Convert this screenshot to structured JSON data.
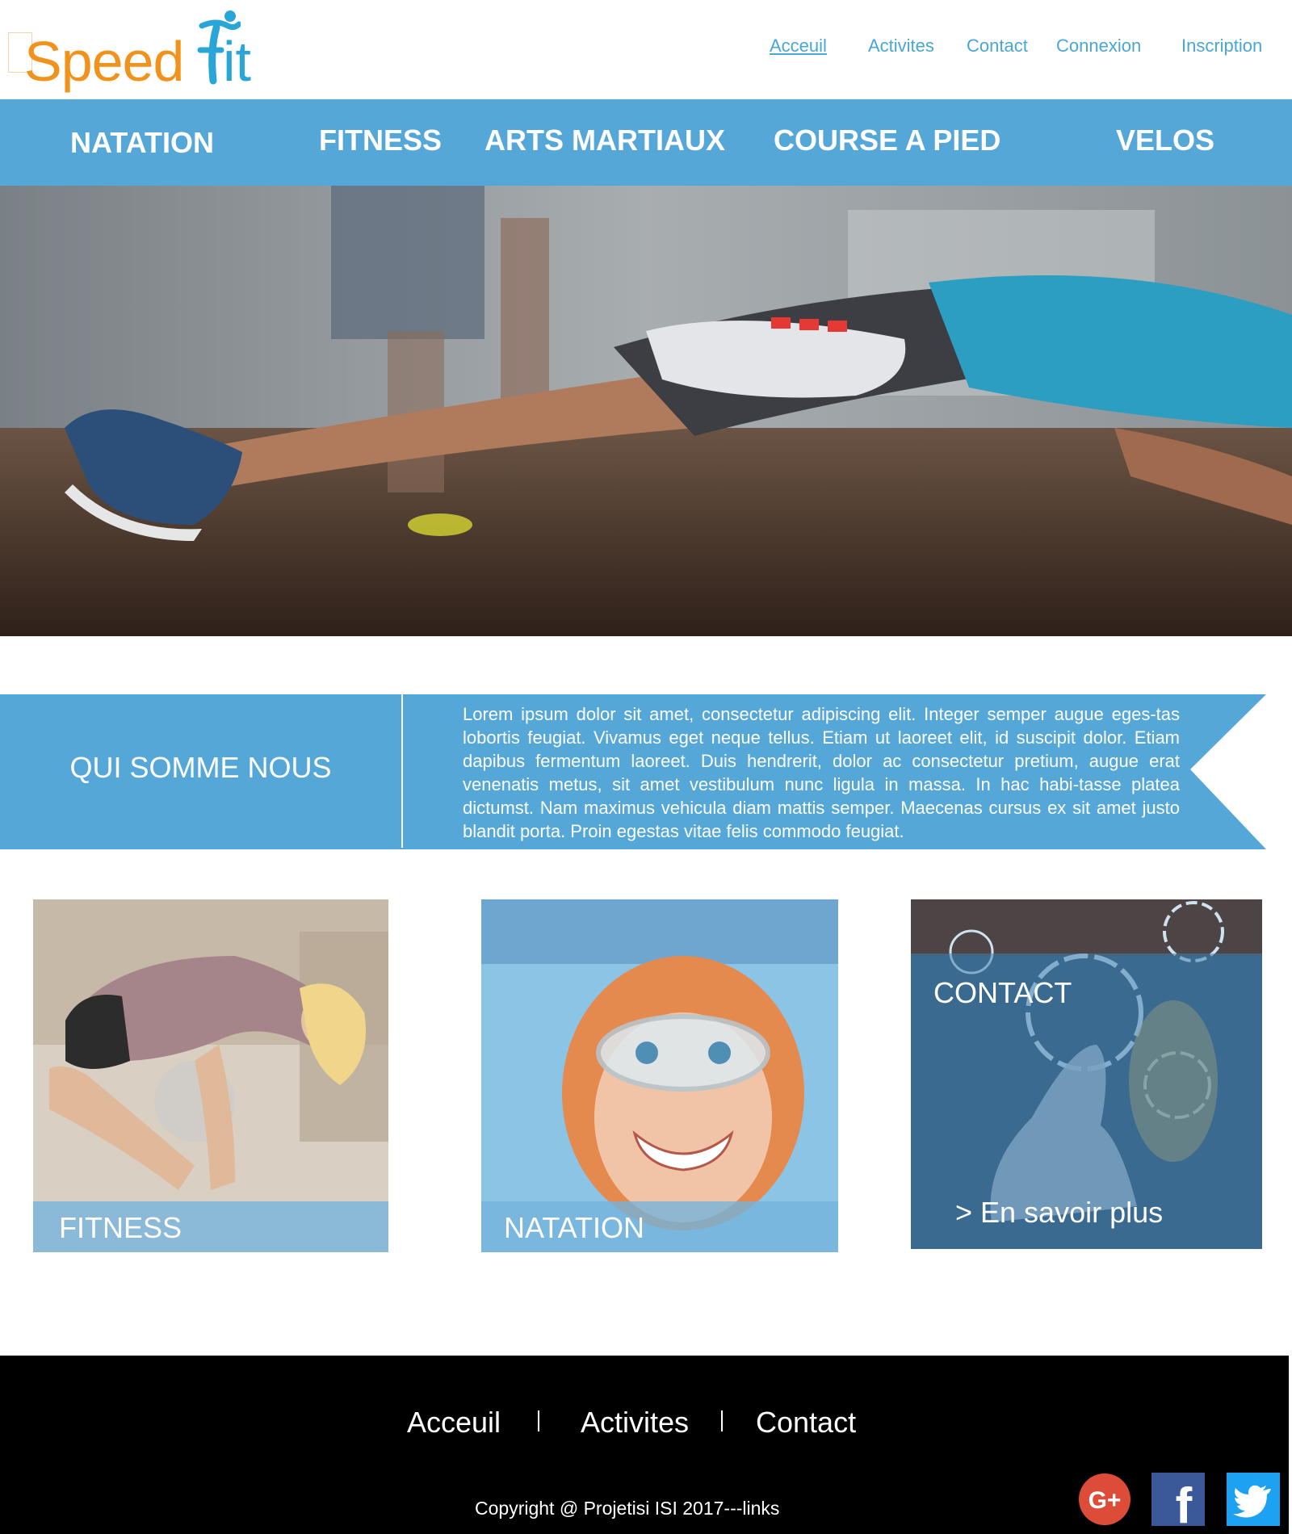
{
  "brand": {
    "part1": "Speed",
    "part2": "it",
    "color_primary": "#f0921b",
    "color_secondary": "#29a5d8"
  },
  "top_nav": {
    "items": [
      {
        "label": "Acceuil",
        "active": true
      },
      {
        "label": "Activites"
      },
      {
        "label": "Contact"
      },
      {
        "label": "Connexion"
      },
      {
        "label": "Inscription"
      }
    ]
  },
  "categories": [
    "NATATION",
    "FITNESS",
    "ARTS MARTIAUX",
    "COURSE A PIED",
    "VELOS"
  ],
  "hero": {
    "image": "workout-sneakers-plank-photo"
  },
  "about": {
    "title": "QUI SOMME NOUS",
    "text": "Lorem ipsum dolor sit amet, consectetur adipiscing elit. Integer semper augue eges-tas lobortis feugiat. Vivamus eget neque tellus. Etiam ut laoreet elit, id suscipit dolor. Etiam dapibus fermentum laoreet. Duis hendrerit, dolor ac consectetur pretium, augue erat venenatis metus, sit amet vestibulum nunc ligula in massa. In hac habi-tasse platea dictumst. Nam maximus vehicula diam mattis semper. Maecenas cursus ex sit amet justo blandit porta. Proin egestas vitae felis commodo feugiat.",
    "accent": "#55a7d8"
  },
  "cards": [
    {
      "label": "FITNESS",
      "image": "woman-fitness-photo"
    },
    {
      "label": "NATATION",
      "image": "girl-swimming-goggles-photo"
    },
    {
      "label": "CONTACT",
      "more": "> En savoir plus",
      "image": "mail-touch-photo"
    }
  ],
  "footer": {
    "nav": [
      "Acceuil",
      "Activites",
      "Contact"
    ],
    "copyright": "Copyright @ Projetisi ISI 2017---links",
    "social": [
      {
        "icon": "google-plus-icon",
        "glyph": "G+",
        "color": "#dd4b39"
      },
      {
        "icon": "facebook-icon",
        "glyph": "f",
        "color": "#3b5998"
      },
      {
        "icon": "twitter-icon",
        "glyph": "t",
        "color": "#1da1f2"
      }
    ]
  }
}
